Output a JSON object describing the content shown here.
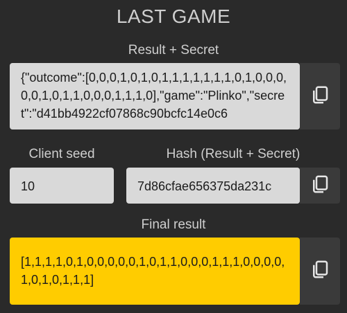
{
  "page": {
    "title": "LAST GAME"
  },
  "result_secret": {
    "label": "Result + Secret",
    "value": "{\"outcome\":[0,0,0,1,0,1,0,1,1,1,1,1,1,1,0,1,0,0,0,0,0,1,0,1,1,0,0,0,1,1,1,0],\"game\":\"Plinko\",\"secret\":\"d41bb4922cf07868c90bcfc14e0c6"
  },
  "client_seed": {
    "label": "Client seed",
    "value": "10"
  },
  "hash": {
    "label": "Hash (Result + Secret)",
    "value": "7d86cfae656375da231c"
  },
  "final_result": {
    "label": "Final result",
    "value": "[1,1,1,1,0,1,0,0,0,0,0,1,0,1,1,0,0,0,1,1,1,0,0,0,0,1,0,1,0,1,1,1]"
  },
  "icons": {
    "copy": "copy-icon"
  }
}
